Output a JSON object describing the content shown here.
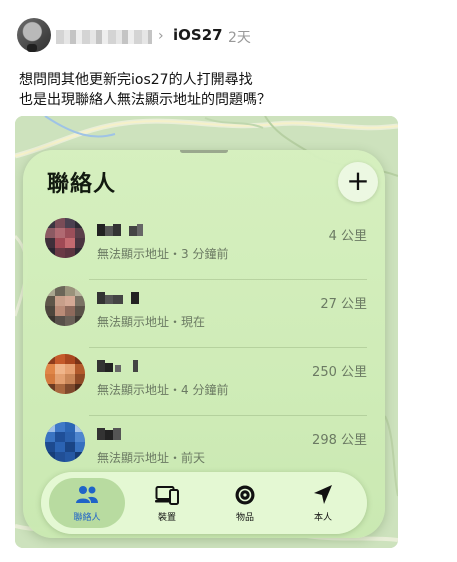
{
  "post": {
    "channel": "iOS27",
    "time": "2天",
    "lines": [
      "想問問其他更新完ios27的人打開尋找",
      "也是出現聯絡人無法顯示地址的問題嗎？"
    ]
  },
  "findmy": {
    "title": "聯絡人",
    "add_label": "+",
    "contacts": [
      {
        "status": "無法顯示地址・3 分鐘前",
        "distance": "4 公里"
      },
      {
        "status": "無法顯示地址・現在",
        "distance": "27 公里"
      },
      {
        "status": "無法顯示地址・4 分鐘前",
        "distance": "250 公里"
      },
      {
        "status": "無法顯示地址・前天",
        "distance": "298 公里"
      }
    ],
    "tabs": [
      {
        "label": "聯絡人",
        "icon": "people-icon",
        "active": true
      },
      {
        "label": "裝置",
        "icon": "devices-icon",
        "active": false
      },
      {
        "label": "物品",
        "icon": "airtag-icon",
        "active": false
      },
      {
        "label": "本人",
        "icon": "location-arrow-icon",
        "active": false
      }
    ]
  },
  "colors": {
    "accent": "#1f63c8",
    "sheet": "#d4efbe",
    "map": "#cfe3bf"
  }
}
